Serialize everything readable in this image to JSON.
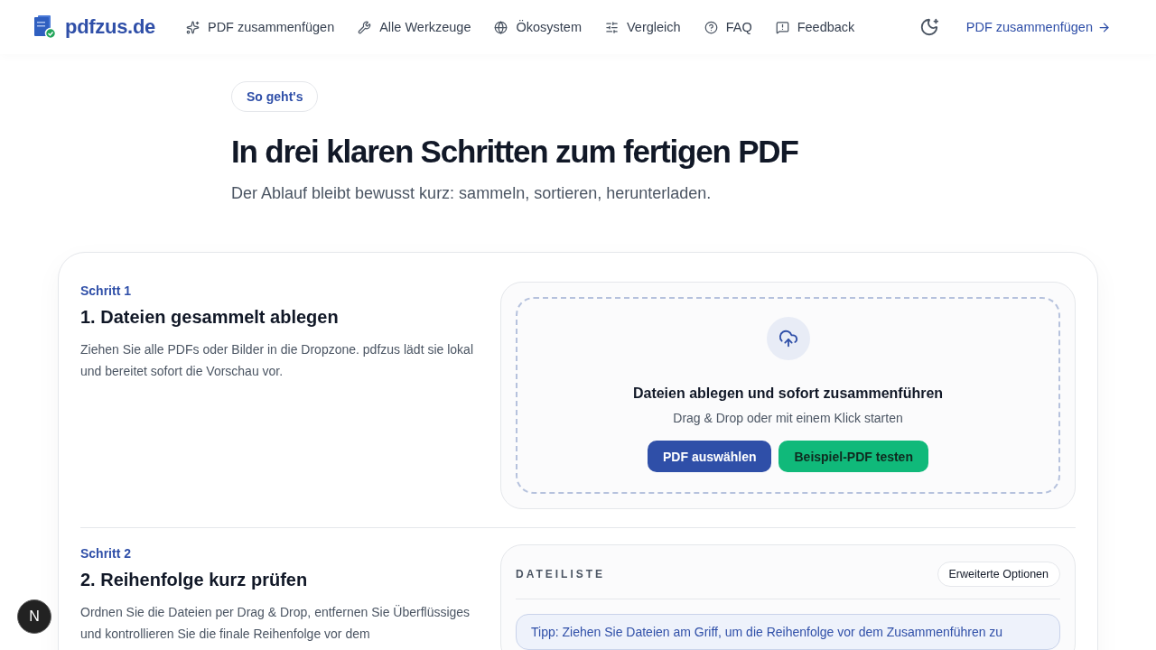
{
  "nav": {
    "brand": "pdfzus.de",
    "links": [
      "PDF zusammenfügen",
      "Alle Werkzeuge",
      "Ökosystem",
      "Vergleich",
      "FAQ",
      "Feedback"
    ],
    "cta": "PDF zusammenfügen"
  },
  "hero": {
    "badge": "So geht's",
    "title": "In drei klaren Schritten zum fertigen PDF",
    "subtitle": "Der Ablauf bleibt bewusst kurz: sammeln, sortieren, herunterladen."
  },
  "steps": [
    {
      "label": "Schritt 1",
      "title": "1. Dateien gesammelt ablegen",
      "text": "Ziehen Sie alle PDFs oder Bilder in die Dropzone. pdfzus lädt sie lokal und bereitet sofort die Vorschau vor.",
      "panel": {
        "kind": "dropzone",
        "title": "Dateien ablegen und sofort zusammenführen",
        "hint": "Drag & Drop oder mit einem Klick starten",
        "buttons": [
          {
            "label": "PDF auswählen",
            "kind": "primary"
          },
          {
            "label": "Beispiel-PDF testen",
            "kind": "success"
          }
        ]
      }
    },
    {
      "label": "Schritt 2",
      "title": "2. Reihenfolge kurz prüfen",
      "text": "Ordnen Sie die Dateien per Drag & Drop, entfernen Sie Überflüssiges und kontrollieren Sie die finale Reihenfolge vor dem",
      "panel": {
        "kind": "filelist",
        "heading": "DATEILISTE",
        "button": "Erweiterte Optionen",
        "tip": "Tipp: Ziehen Sie Dateien am Griff, um die Reihenfolge vor dem Zusammenführen zu"
      }
    }
  ],
  "dev_badge": "N"
}
